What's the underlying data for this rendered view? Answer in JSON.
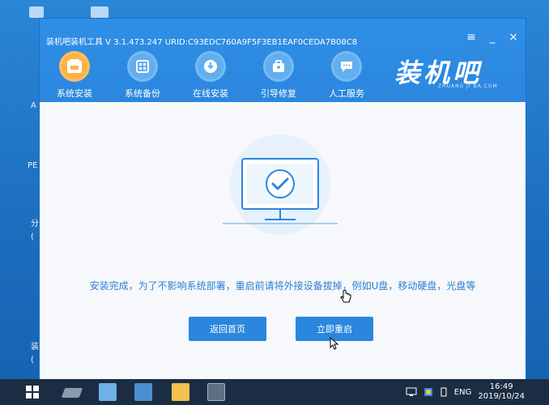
{
  "window": {
    "title": "装机吧装机工具 V 3.1.473.247 URID:C93EDC760A9F5F3EB1EAF0CEDA7B08C8",
    "controls": {
      "menu": "≡",
      "minimize": "_",
      "close": "×"
    }
  },
  "nav": {
    "items": [
      {
        "label": "系统安装",
        "icon": "system-install-icon"
      },
      {
        "label": "系统备份",
        "icon": "system-backup-icon"
      },
      {
        "label": "在线安装",
        "icon": "online-install-icon"
      },
      {
        "label": "引导修复",
        "icon": "boot-repair-icon"
      },
      {
        "label": "人工服务",
        "icon": "support-chat-icon"
      }
    ],
    "active_index": 0
  },
  "brand": {
    "name": "装机吧",
    "sub": "ZHUANG JI BA.COM"
  },
  "content": {
    "message": "安装完成，为了不影响系统部署，重启前请将外接设备拔掉，例如U盘，移动硬盘，光盘等",
    "buttons": {
      "home": "返回首页",
      "restart": "立即重启"
    }
  },
  "desktop": {
    "labels": [
      "A",
      "PE",
      "分",
      "(",
      "装",
      "("
    ]
  },
  "taskbar": {
    "language": "ENG",
    "time": "16:49",
    "date": "2019/10/24"
  },
  "colors": {
    "accent": "#2b86de",
    "header": "#2f8fe6",
    "taskbar": "#1b2d42",
    "active_nav": "#ffb347"
  }
}
